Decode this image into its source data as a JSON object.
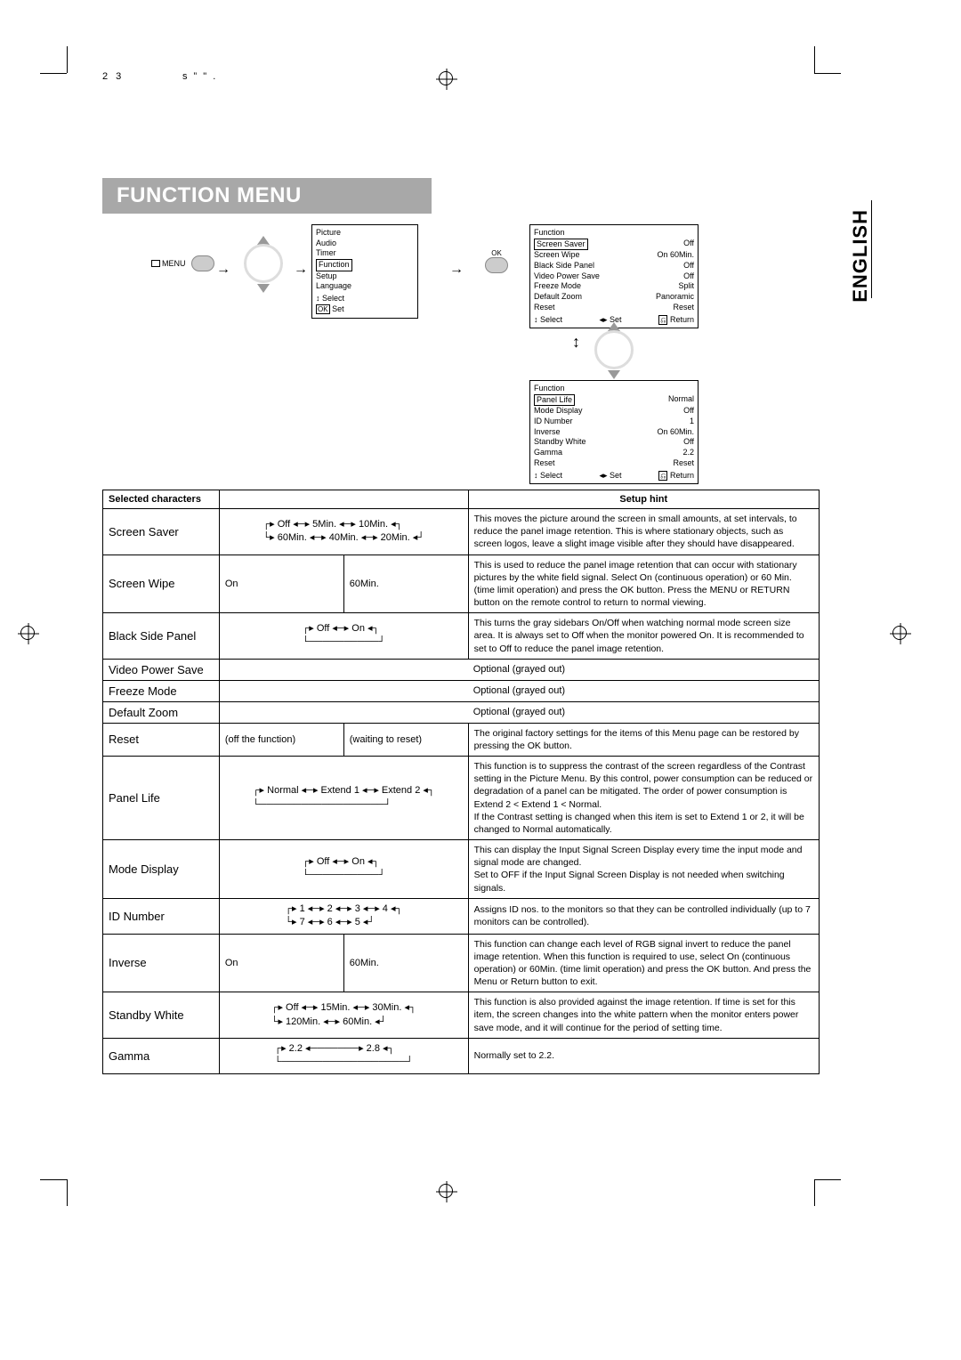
{
  "page_number": "2 3",
  "header_fragment": "s ” \" .",
  "language_tab": "ENGLISH",
  "title": "FUNCTION MENU",
  "remote_label": "MENU",
  "ok_label": "OK",
  "main_menu": {
    "items": [
      "Picture",
      "Audio",
      "Timer",
      "Function",
      "Setup",
      "Language"
    ],
    "selected_index": 3,
    "select_hint": "Select",
    "set_hint": "Set",
    "set_key": "OK"
  },
  "function_menu_1": {
    "title": "Function",
    "rows": [
      {
        "label": "Screen Saver",
        "value": "Off",
        "selected": true
      },
      {
        "label": "Screen Wipe",
        "value": "On  60Min."
      },
      {
        "label": "Black Side Panel",
        "value": "Off"
      },
      {
        "label": "Video Power Save",
        "value": "Off"
      },
      {
        "label": "Freeze Mode",
        "value": "Split"
      },
      {
        "label": "Default Zoom",
        "value": "Panoramic"
      },
      {
        "label": "Reset",
        "value": "Reset"
      }
    ],
    "footer": {
      "select": "Select",
      "set": "Set",
      "return": "Return"
    }
  },
  "function_menu_2": {
    "title": "Function",
    "rows": [
      {
        "label": "Panel Life",
        "value": "Normal",
        "selected": true
      },
      {
        "label": "Mode Display",
        "value": "Off"
      },
      {
        "label": "ID Number",
        "value": "1"
      },
      {
        "label": "Inverse",
        "value": "On  60Min."
      },
      {
        "label": "Standby White",
        "value": "Off"
      },
      {
        "label": "Gamma",
        "value": "2.2"
      },
      {
        "label": "Reset",
        "value": "Reset"
      }
    ],
    "footer": {
      "select": "Select",
      "set": "Set",
      "return": "Return"
    }
  },
  "table": {
    "headers": {
      "characters": "Selected characters",
      "hint": "Setup hint"
    },
    "rows": [
      {
        "name": "Screen Saver",
        "options_line1": "Off ◂─▸ 5Min. ◂─▸ 10Min.",
        "options_line2": "60Min. ◂─▸ 40Min. ◂─▸ 20Min.",
        "loop": true,
        "hint": "This moves the picture around the screen in small amounts, at set intervals, to reduce the panel image retention. This is where stationary objects, such as screen logos, leave a slight image visible after they should have disappeared."
      },
      {
        "name": "Screen Wipe",
        "col1": "On",
        "col2": "60Min.",
        "hint": "This is used to reduce the panel image retention that can occur with stationary pictures by the white field signal. Select On (continuous operation) or 60 Min. (time limit operation) and press the OK button. Press the MENU or RETURN button on the remote control to return to normal viewing."
      },
      {
        "name": "Black Side Panel",
        "options_line1": "Off ◂─▸ On",
        "loop": true,
        "hint": "This turns the gray sidebars On/Off when watching normal mode screen size area. It is always set to Off when the monitor powered On. It is recommended to set to Off to reduce the panel image retention."
      },
      {
        "name": "Video Power Save",
        "span_text": "Optional (grayed out)"
      },
      {
        "name": "Freeze Mode",
        "span_text": "Optional (grayed out)"
      },
      {
        "name": "Default Zoom",
        "span_text": "Optional (grayed out)"
      },
      {
        "name": "Reset",
        "col1": "(off the function)",
        "col2": "(waiting to reset)",
        "hint": "The original factory settings for the items of this Menu page can be restored by pressing the OK button."
      },
      {
        "name": "Panel Life",
        "options_line1": "Normal ◂─▸ Extend 1 ◂─▸ Extend 2",
        "loop_single": true,
        "hint": "This function is to suppress the contrast of the screen regardless of the Contrast setting in the Picture Menu. By this control, power consumption can be reduced or degradation of a panel can be mitigated. The order of power consumption is Extend 2 < Extend 1 < Normal.\nIf the Contrast setting is changed when this item is set to Extend 1 or 2, it will be changed to Normal automatically."
      },
      {
        "name": "Mode Display",
        "options_line1": "Off ◂─▸ On",
        "loop": true,
        "hint": "This can display the Input Signal Screen Display every time the input mode and signal mode are changed.\nSet to OFF if the Input Signal Screen Display is not needed when switching signals."
      },
      {
        "name": "ID Number",
        "options_line1": "1 ◂─▸ 2 ◂─▸ 3 ◂─▸ 4",
        "options_line2": "7 ◂─▸ 6 ◂─▸ 5",
        "loop": true,
        "hint": "Assigns ID nos. to the monitors so that they can be controlled individually (up to 7 monitors can be controlled)."
      },
      {
        "name": "Inverse",
        "col1": "On",
        "col2": "60Min.",
        "hint": "This function can change each level of RGB signal invert to reduce the panel image retention. When this function is required to use, select On (continuous operation) or 60Min. (time limit operation) and press the OK button. And press the Menu or Return button to exit."
      },
      {
        "name": "Standby White",
        "options_line1": "Off ◂─▸ 15Min. ◂─▸ 30Min.",
        "options_line2": "120Min. ◂─▸ 60Min.",
        "loop": true,
        "hint": "This function is also provided against the image retention. If time is set for this item, the screen changes into the white pattern when the monitor enters power save mode, and it will continue for the period of setting time."
      },
      {
        "name": "Gamma",
        "options_line1": "2.2 ◂───────▸ 2.8",
        "loop_single": true,
        "hint": "Normally set to 2.2."
      }
    ]
  }
}
